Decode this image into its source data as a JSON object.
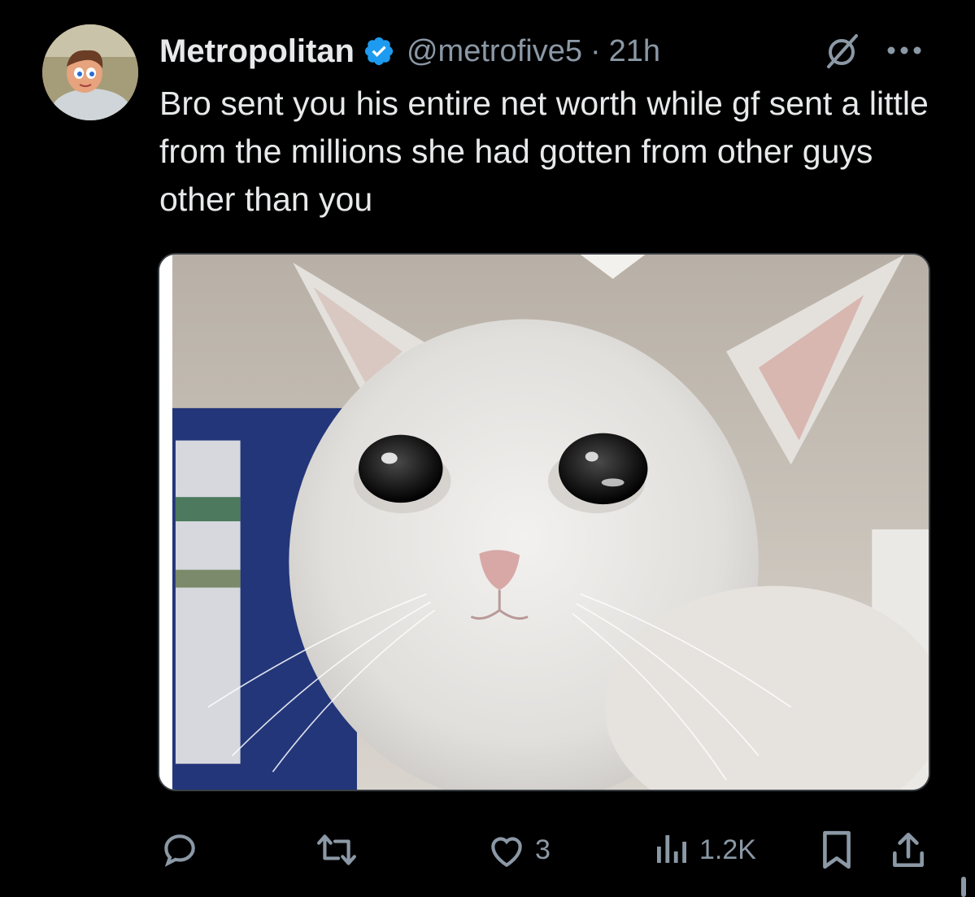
{
  "tweet": {
    "display_name": "Metropolitan",
    "handle": "@metrofive5",
    "separator": "·",
    "timestamp": "21h",
    "text": "Bro sent you his entire net worth while gf sent a little from the millions she had gotten from other guys other than you",
    "verified": true
  },
  "icons": {
    "verified": "verified-badge-icon",
    "grok": "grok-icon",
    "more": "more-options-icon",
    "reply": "reply-icon",
    "repost": "repost-icon",
    "like": "like-icon",
    "views": "views-icon",
    "bookmark": "bookmark-icon",
    "share": "share-icon"
  },
  "actions": {
    "reply_count": "",
    "repost_count": "",
    "like_count": "3",
    "views_count": "1.2K"
  },
  "colors": {
    "background": "#000000",
    "text_primary": "#e7e9ea",
    "text_secondary": "#8b98a5",
    "verified_blue": "#1d9bf0"
  }
}
